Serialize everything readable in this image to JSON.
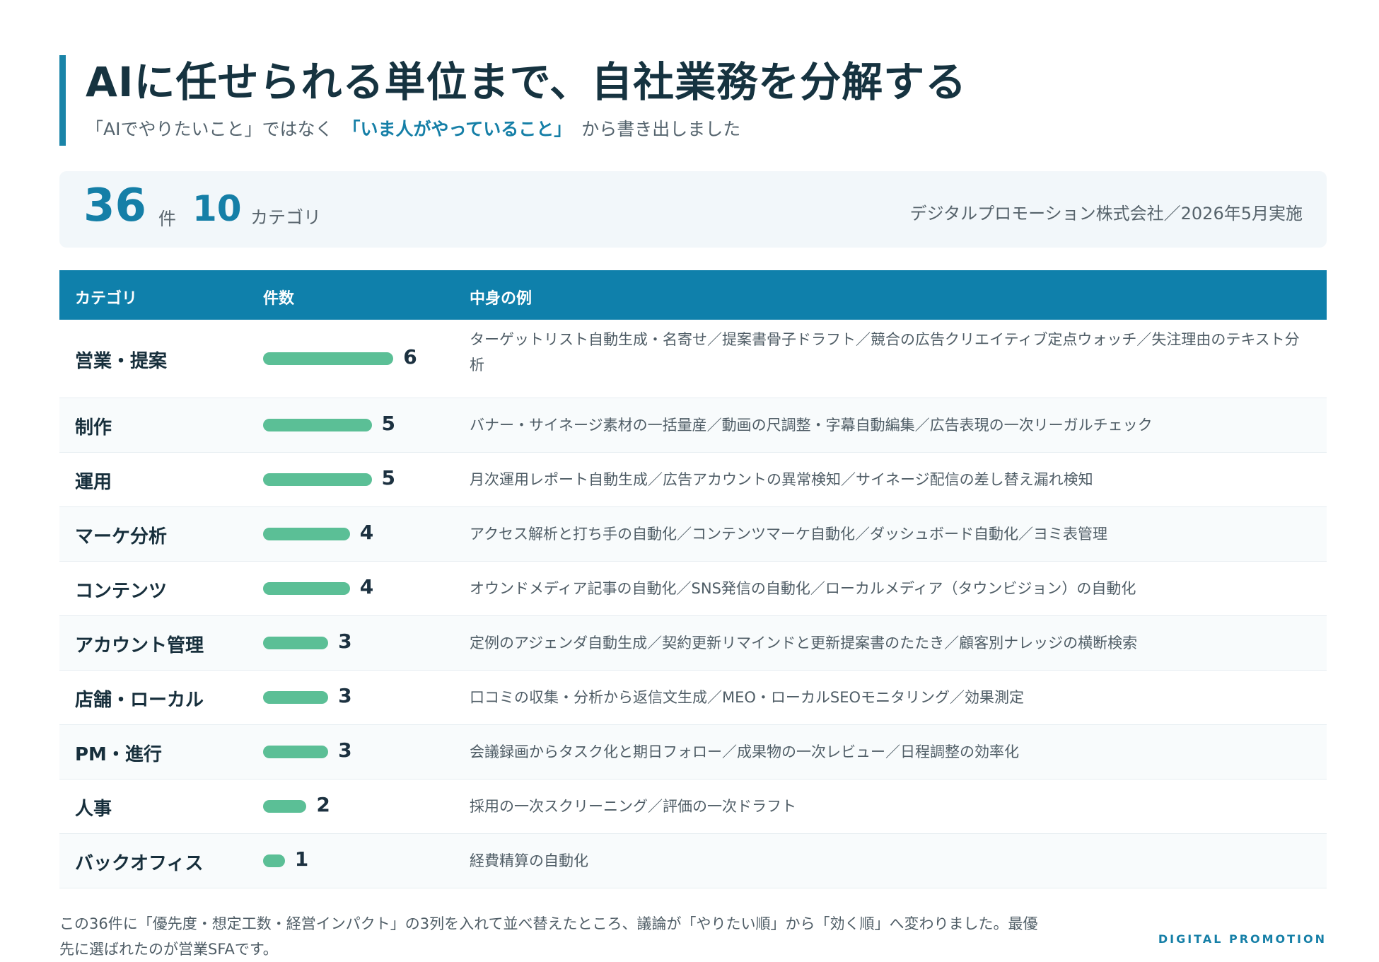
{
  "header": {
    "title": "AIに任せられる単位まで、自社業務を分解する",
    "subtitle_pre": "「AIでやりたいこと」ではなく",
    "subtitle_highlight": "「いま人がやっていること」",
    "subtitle_post": "から書き出しました"
  },
  "stats": {
    "item_count": "36",
    "item_unit": "件",
    "category_count": "10",
    "category_unit": "カテゴリ",
    "meta": "デジタルプロモーション株式会社／2026年5月実施"
  },
  "table": {
    "headers": [
      "カテゴリ",
      "件数",
      "中身の例"
    ],
    "rows": [
      {
        "category": "営業・提案",
        "count": 6,
        "example": "ターゲットリスト自動生成・名寄せ／提案書骨子ドラフト／競合の広告クリエイティブ定点ウォッチ／失注理由のテキスト分析"
      },
      {
        "category": "制作",
        "count": 5,
        "example": "バナー・サイネージ素材の一括量産／動画の尺調整・字幕自動編集／広告表現の一次リーガルチェック"
      },
      {
        "category": "運用",
        "count": 5,
        "example": "月次運用レポート自動生成／広告アカウントの異常検知／サイネージ配信の差し替え漏れ検知"
      },
      {
        "category": "マーケ分析",
        "count": 4,
        "example": "アクセス解析と打ち手の自動化／コンテンツマーケ自動化／ダッシュボード自動化／ヨミ表管理"
      },
      {
        "category": "コンテンツ",
        "count": 4,
        "example": "オウンドメディア記事の自動化／SNS発信の自動化／ローカルメディア（タウンビジョン）の自動化"
      },
      {
        "category": "アカウント管理",
        "count": 3,
        "example": "定例のアジェンダ自動生成／契約更新リマインドと更新提案書のたたき／顧客別ナレッジの横断検索"
      },
      {
        "category": "店舗・ローカル",
        "count": 3,
        "example": "口コミの収集・分析から返信文生成／MEO・ローカルSEOモニタリング／効果測定"
      },
      {
        "category": "PM・進行",
        "count": 3,
        "example": "会議録画からタスク化と期日フォロー／成果物の一次レビュー／日程調整の効率化"
      },
      {
        "category": "人事",
        "count": 2,
        "example": "採用の一次スクリーニング／評価の一次ドラフト"
      },
      {
        "category": "バックオフィス",
        "count": 1,
        "example": "経費精算の自動化"
      }
    ]
  },
  "footer": {
    "text": "この36件に「優先度・想定工数・経営インパクト」の3列を入れて並べ替えたところ、議論が「やりたい順」から「効く順」へ変わりました。最優先に選ばれたのが営業SFAです。",
    "brand": "DIGITAL PROMOTION"
  },
  "colors": {
    "accent": "#157fa7",
    "header_bg": "#0f80ab",
    "bar": "#5bbf96",
    "stats_bg": "#f2f7fa"
  }
}
